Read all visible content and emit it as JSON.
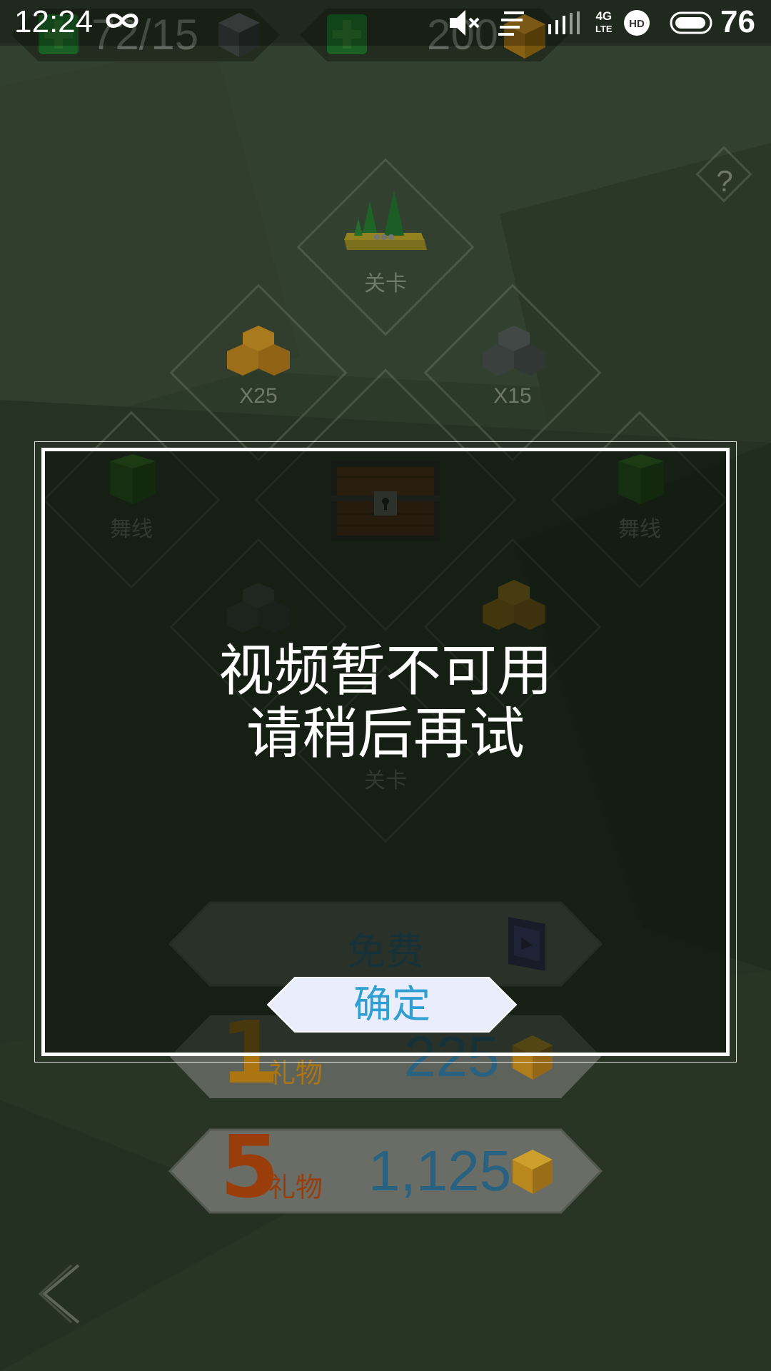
{
  "status_bar": {
    "time": "12:24",
    "battery_level": "76",
    "network": "4G",
    "network_sub": "LTE",
    "icons": [
      "infinity-icon",
      "mute-icon",
      "menu-lines-icon",
      "signal-icon",
      "hd-icon",
      "battery-icon"
    ]
  },
  "resources": {
    "cubes_count": "72/15",
    "gems_count": "200"
  },
  "menu": {
    "level_top_label": "关卡",
    "gold_reward_label": "X25",
    "gray_reward_label": "X15",
    "left_dance_label": "舞线",
    "right_dance_label": "舞线",
    "level_bottom_label": "关卡",
    "help_symbol": "?"
  },
  "shop": {
    "free_label": "免费",
    "gift1_count": "1",
    "gift1_unit": "礼物",
    "gift1_price": "225",
    "gift5_count": "5",
    "gift5_unit": "礼物",
    "gift5_price": "1,125"
  },
  "dialog": {
    "line1": "视频暂不可用",
    "line2": "请稍后再试",
    "ok_label": "确定"
  },
  "colors": {
    "background": "#33422f",
    "accent_blue": "#2f9fd3",
    "gold": "#e0a21e",
    "orange": "#c4550f",
    "dialog_border": "#ffffff"
  }
}
